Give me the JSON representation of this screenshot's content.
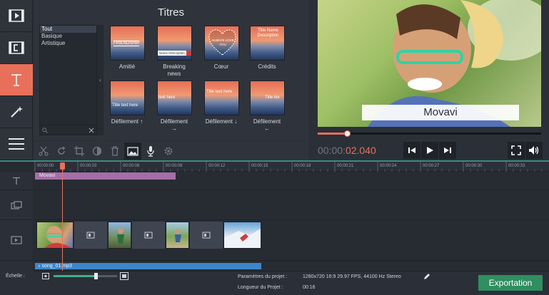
{
  "titles_panel": {
    "heading": "Titres",
    "categories": [
      "Tout",
      "Basique",
      "Artistique"
    ],
    "tiles": [
      {
        "label": "Amitié",
        "text": "FRIENDSHIP"
      },
      {
        "label": "Breaking\nnews",
        "text": "Name Description"
      },
      {
        "label": "Cœur",
        "text": "ALWAYS LOVE YOU"
      },
      {
        "label": "Crédits",
        "text": "Title Name Description"
      },
      {
        "label": "Défilement ↑",
        "text": "Title text here"
      },
      {
        "label": "Défilement\n→",
        "text": "text here"
      },
      {
        "label": "Défilement ↓",
        "text": "Title text here"
      },
      {
        "label": "Défilement\n←",
        "text": "Title tex"
      }
    ]
  },
  "preview": {
    "title_text": "Movavi",
    "progress": 0.13
  },
  "player": {
    "time_dim": "00:00:",
    "time_hot": "02.040"
  },
  "timeline": {
    "ruler_ticks": [
      "00:00:00",
      "00:00:03",
      "00:00:06",
      "00:00:09",
      "00:00:12",
      "00:00:15",
      "00:00:18",
      "00:00:21",
      "00:00:24",
      "00:00:27",
      "00:00:30",
      "00:00:33"
    ],
    "title_clip": "Movavi",
    "audio_clip": "song_01.mp3"
  },
  "bottom": {
    "scale_label": "Échelle :",
    "params_label": "Paramètres du projet :",
    "params_value": "1280x720 16:9 29.97 FPS, 44100 Hz Stereo",
    "duration_label": "Longueur du Projet :",
    "duration_value": "00:16",
    "export_label": "Exportation"
  },
  "colors": {
    "accent": "#e8705a",
    "export": "#2f8f5f",
    "title_clip": "#a46ea6",
    "audio_clip": "#3d86c9"
  }
}
